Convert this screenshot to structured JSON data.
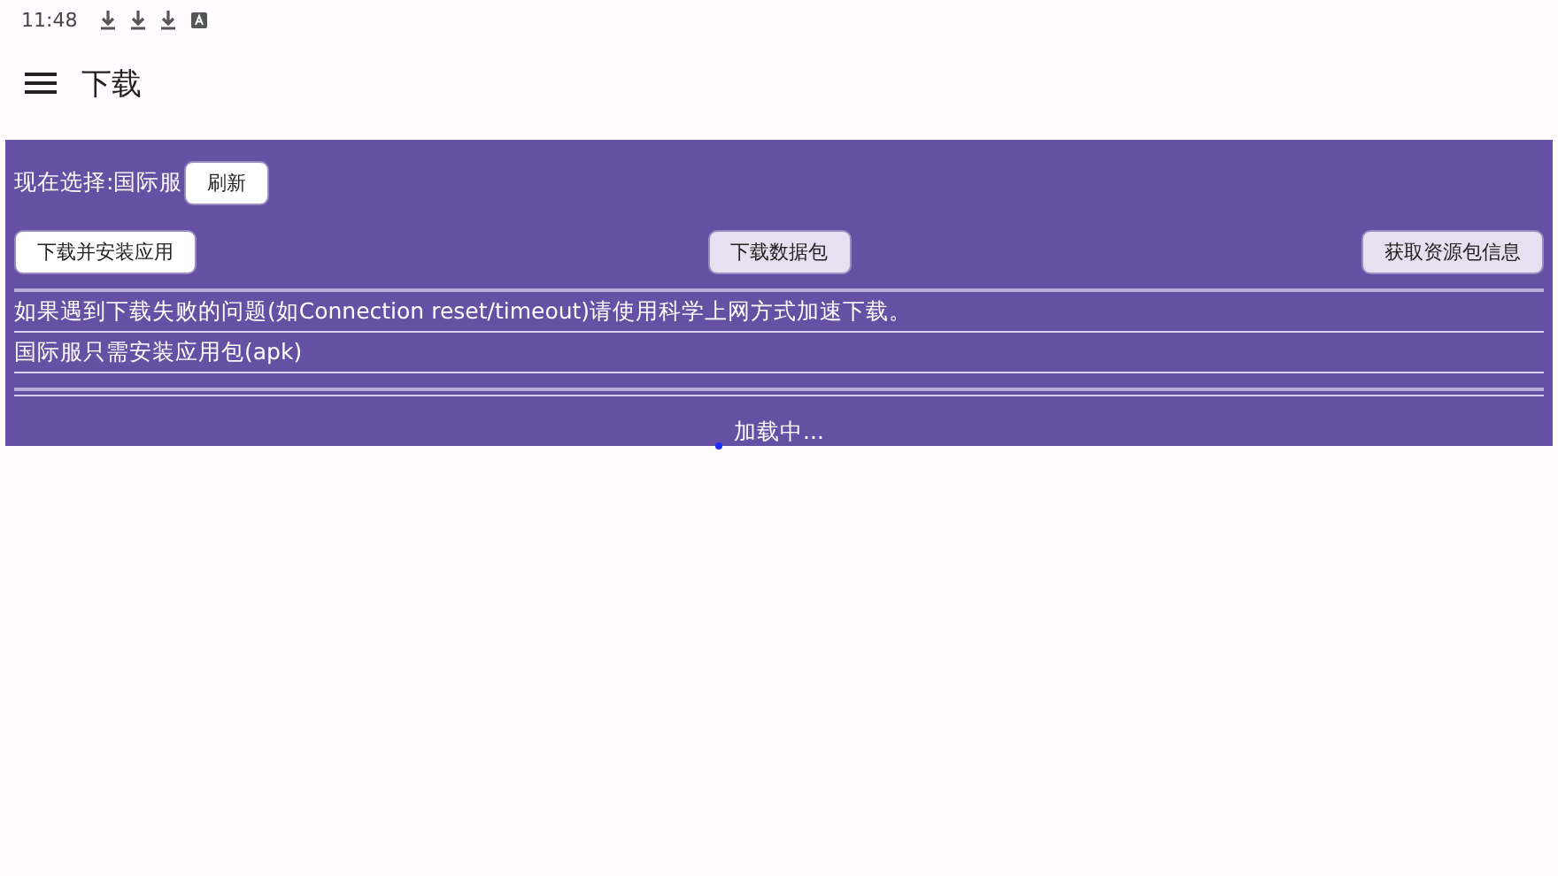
{
  "status_bar": {
    "time": "11:48"
  },
  "app_bar": {
    "title": "下载"
  },
  "panel": {
    "selection_label": "现在选择:国际服",
    "refresh_button": "刷新",
    "actions": [
      {
        "label": "下载并安装应用",
        "kind": "light"
      },
      {
        "label": "下载数据包",
        "kind": "tinted"
      },
      {
        "label": "获取资源包信息",
        "kind": "tinted"
      }
    ],
    "notes": [
      "如果遇到下载失败的问题(如Connection reset/timeout)请使用科学上网方式加速下载。",
      "国际服只需安装应用包(apk)"
    ],
    "loading_text": "加载中..."
  }
}
